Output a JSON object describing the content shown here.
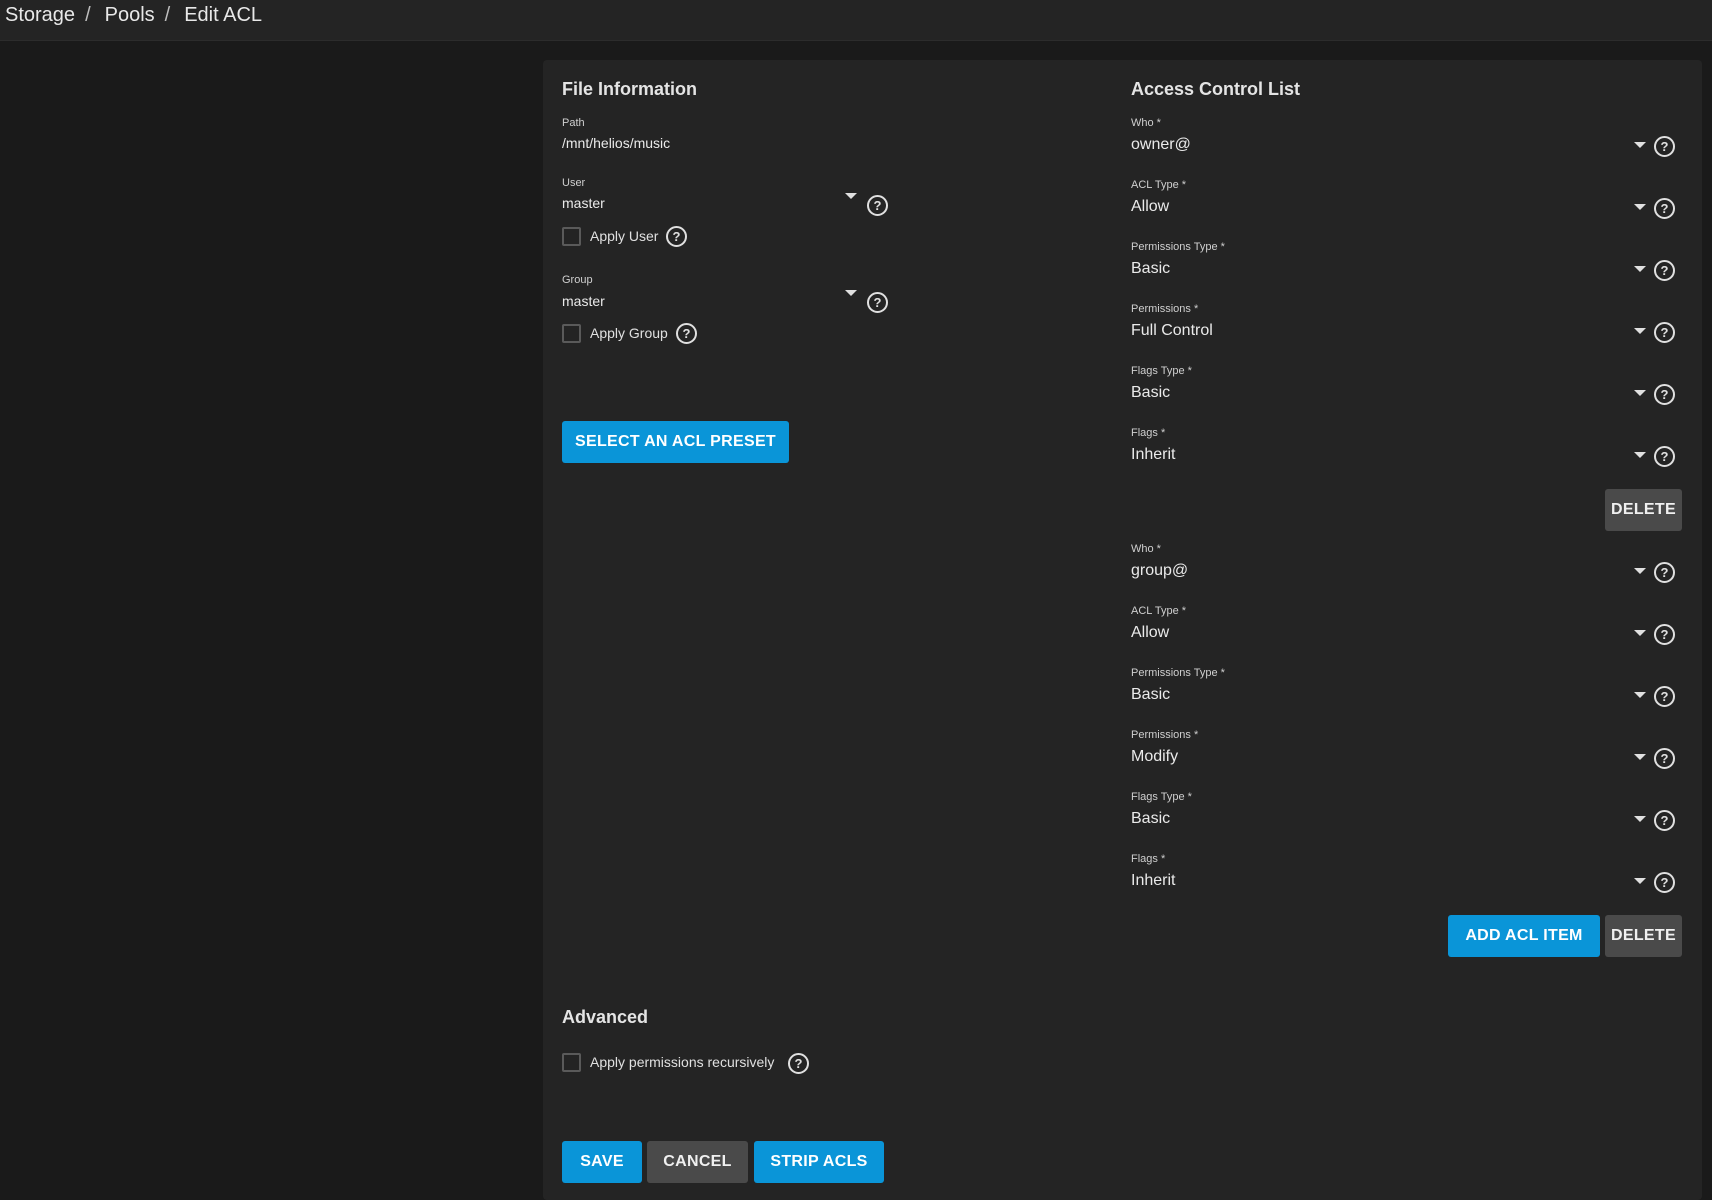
{
  "breadcrumb": {
    "items": [
      "Storage",
      "Pools",
      "Edit ACL"
    ],
    "separator": "/"
  },
  "file_info": {
    "title": "File Information",
    "path_label": "Path",
    "path_value": "/mnt/helios/music",
    "user_label": "User",
    "user_value": "master",
    "apply_user_label": "Apply User",
    "group_label": "Group",
    "group_value": "master",
    "apply_group_label": "Apply Group",
    "preset_button": "SELECT AN ACL PRESET"
  },
  "acl": {
    "title": "Access Control List",
    "entries": [
      {
        "fields": [
          {
            "label": "Who *",
            "value": "owner@"
          },
          {
            "label": "ACL Type *",
            "value": "Allow"
          },
          {
            "label": "Permissions Type *",
            "value": "Basic"
          },
          {
            "label": "Permissions *",
            "value": "Full Control"
          },
          {
            "label": "Flags Type *",
            "value": "Basic"
          },
          {
            "label": "Flags *",
            "value": "Inherit"
          }
        ],
        "delete_label": "DELETE"
      },
      {
        "fields": [
          {
            "label": "Who *",
            "value": "group@"
          },
          {
            "label": "ACL Type *",
            "value": "Allow"
          },
          {
            "label": "Permissions Type *",
            "value": "Basic"
          },
          {
            "label": "Permissions *",
            "value": "Modify"
          },
          {
            "label": "Flags Type *",
            "value": "Basic"
          },
          {
            "label": "Flags *",
            "value": "Inherit"
          }
        ],
        "delete_label": "DELETE"
      }
    ],
    "add_label": "ADD ACL ITEM"
  },
  "advanced": {
    "title": "Advanced",
    "recursive_label": "Apply permissions recursively"
  },
  "actions": {
    "save": "SAVE",
    "cancel": "CANCEL",
    "strip": "STRIP ACLS"
  },
  "colors": {
    "primary": "#0a95d8",
    "grey_button": "#4a4a4a",
    "card": "#242424",
    "background": "#1a1a1a"
  },
  "icons": {
    "help": "help-circle-icon",
    "dropdown": "caret-down-icon"
  }
}
